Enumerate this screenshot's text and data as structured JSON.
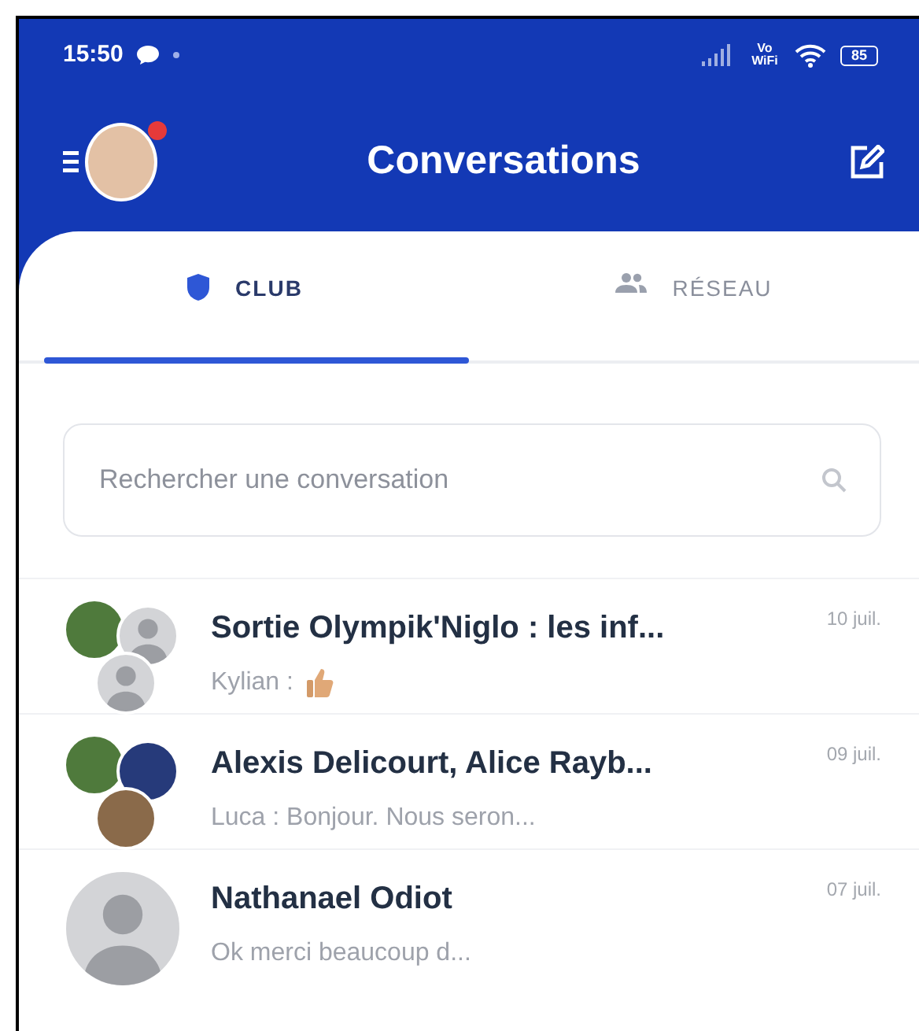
{
  "status_bar": {
    "time": "15:50",
    "network_label": "Vo WiFi",
    "battery": "85"
  },
  "header": {
    "title": "Conversations",
    "profile_notification": true
  },
  "tabs": [
    {
      "label": "CLUB",
      "kind": "shield",
      "selected": true
    },
    {
      "label": "RÉSEAU",
      "kind": "people",
      "selected": false
    }
  ],
  "search": {
    "placeholder": "Rechercher une conversation"
  },
  "conversations": [
    {
      "title": "Sortie Olympik'Niglo : les inf...",
      "preview": "Kylian :",
      "thumbs_up": true,
      "date": "10 juil.",
      "avatars": [
        {
          "kind": "photo"
        },
        {
          "kind": "silhouette"
        },
        {
          "kind": "silhouette"
        }
      ]
    },
    {
      "title": "Alexis Delicourt, Alice Rayb...",
      "preview": "Luca : Bonjour. Nous seron...",
      "thumbs_up": false,
      "date": "09 juil.",
      "avatars": [
        {
          "kind": "photo"
        },
        {
          "kind": "photo"
        },
        {
          "kind": "photo"
        }
      ]
    },
    {
      "title": "Nathanael Odiot",
      "preview": "Ok merci beaucoup d...",
      "thumbs_up": false,
      "date": "07 juil.",
      "avatars": [
        {
          "kind": "silhouette"
        }
      ]
    }
  ]
}
